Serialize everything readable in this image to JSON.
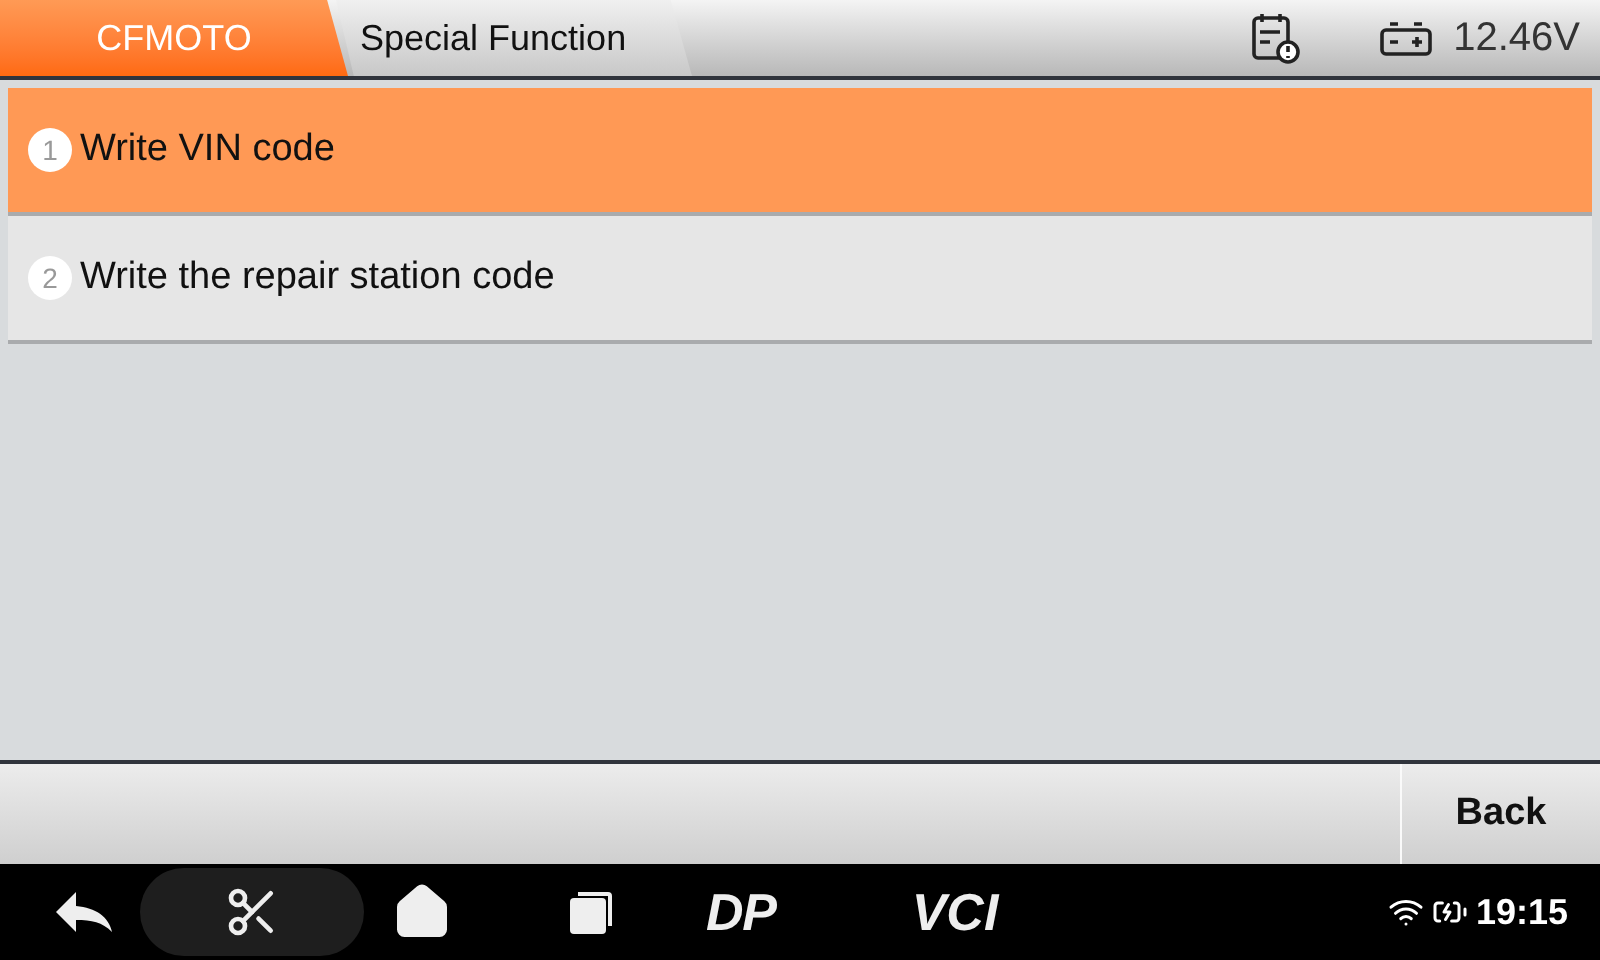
{
  "tabs": [
    {
      "label": "CFMOTO",
      "selected": true
    },
    {
      "label": "Special Function",
      "selected": false
    }
  ],
  "status": {
    "voltage": "12.46V"
  },
  "items": [
    {
      "number": "1",
      "label": "Write VIN code",
      "selected": true
    },
    {
      "number": "2",
      "label": "Write the repair station code",
      "selected": false
    }
  ],
  "buttons": [
    "Back"
  ],
  "nav_bar": {
    "dp_label": "DP",
    "vci_label": "VCI",
    "time": "19:15"
  }
}
